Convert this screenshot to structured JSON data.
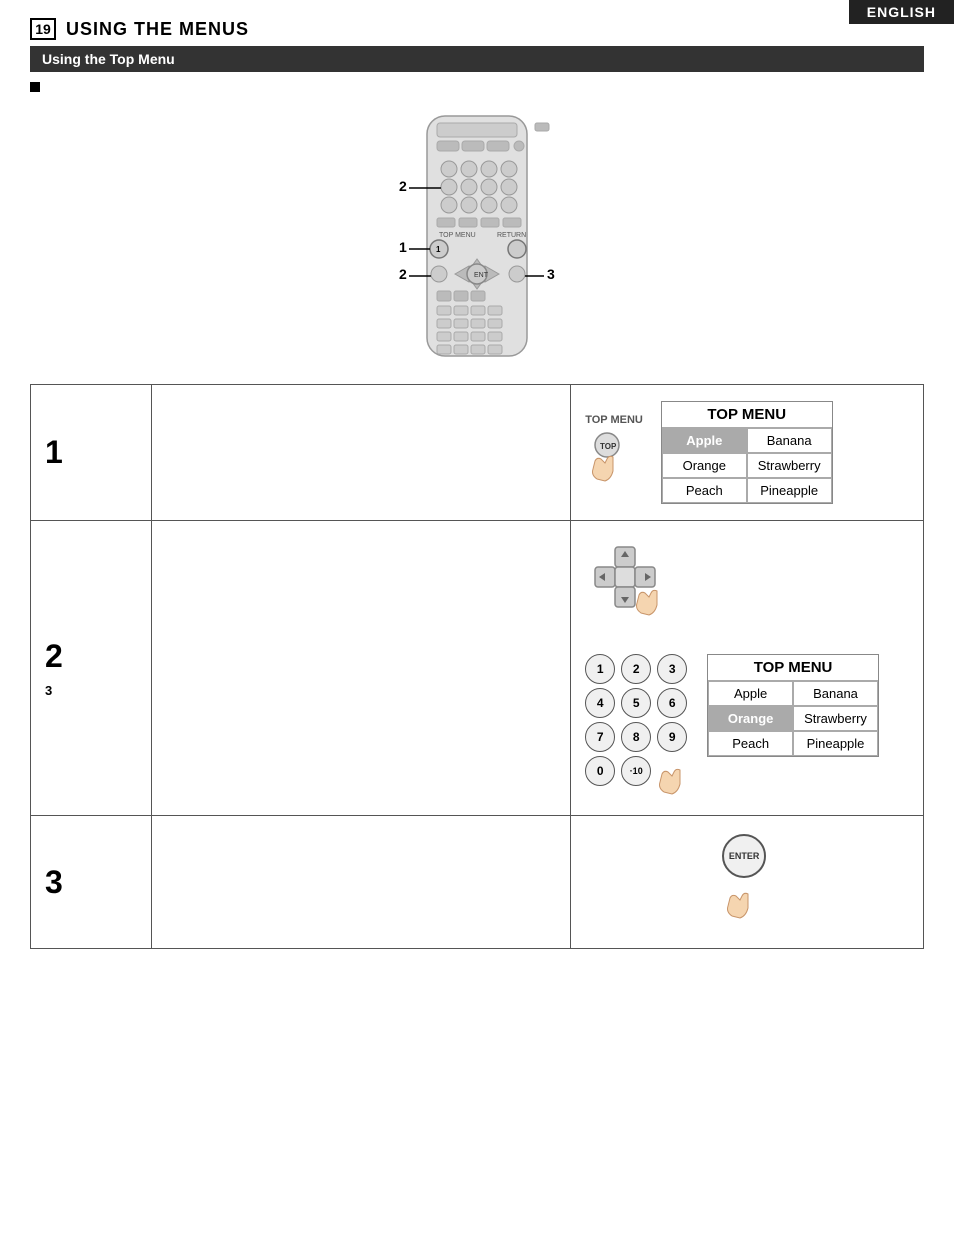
{
  "badge": {
    "text": "ENGLISH"
  },
  "header": {
    "section_number": "19",
    "title": "USING THE MENUS"
  },
  "section_banner": {
    "text": "Using the Top Menu"
  },
  "steps": [
    {
      "number": "1",
      "description": "",
      "visual_label": "TOP MENU",
      "menu_title": "TOP MENU",
      "menu_items": [
        {
          "label": "Apple",
          "selected": true
        },
        {
          "label": "Banana",
          "selected": false
        },
        {
          "label": "Orange",
          "selected": false
        },
        {
          "label": "Strawberry",
          "selected": false
        },
        {
          "label": "Peach",
          "selected": false
        },
        {
          "label": "Pineapple",
          "selected": false
        }
      ]
    },
    {
      "number": "2",
      "sub_step": "3",
      "description": "",
      "menu_title": "TOP MENU",
      "menu_items": [
        {
          "label": "Apple",
          "selected": false
        },
        {
          "label": "Banana",
          "selected": false
        },
        {
          "label": "Orange",
          "selected": true
        },
        {
          "label": "Strawberry",
          "selected": false
        },
        {
          "label": "Peach",
          "selected": false
        },
        {
          "label": "Pineapple",
          "selected": false
        }
      ],
      "numpad": [
        "1",
        "2",
        "3",
        "4",
        "5",
        "6",
        "7",
        "8",
        "9",
        "0",
        "·10",
        "↑"
      ]
    },
    {
      "number": "3",
      "description": "",
      "enter_label": "ENTER"
    }
  ],
  "remote": {
    "label1": "1",
    "label2": "2",
    "label3": "3"
  }
}
